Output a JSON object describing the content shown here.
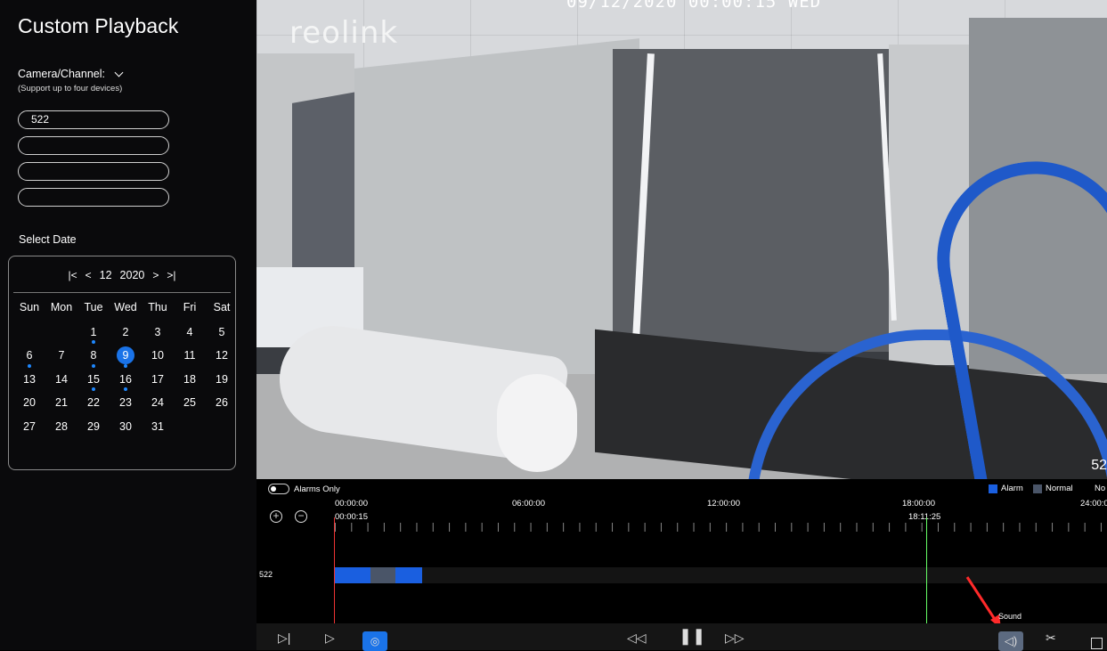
{
  "sidebar": {
    "title": "Custom Playback",
    "camera_label": "Camera/Channel:",
    "camera_sub": "(Support up to four devices)",
    "devices": [
      "522",
      "",
      "",
      ""
    ],
    "select_date": "Select Date"
  },
  "calendar": {
    "month": "12",
    "year": "2020",
    "weekdays": [
      "Sun",
      "Mon",
      "Tue",
      "Wed",
      "Thu",
      "Fri",
      "Sat"
    ],
    "days": [
      "",
      "",
      "1",
      "2",
      "3",
      "4",
      "5",
      "6",
      "7",
      "8",
      "9",
      "10",
      "11",
      "12",
      "13",
      "14",
      "15",
      "16",
      "17",
      "18",
      "19",
      "20",
      "21",
      "22",
      "23",
      "24",
      "25",
      "26",
      "27",
      "28",
      "29",
      "30",
      "31",
      "",
      ""
    ],
    "selected_day": "9",
    "days_with_recordings": [
      "1",
      "6",
      "8",
      "9",
      "15",
      "16"
    ]
  },
  "video": {
    "watermark": "reolink",
    "osd_timestamp": "09/12/2020 00:00:15 WED",
    "channel_overlay": "52"
  },
  "timeline": {
    "alarms_only": "Alarms Only",
    "legend": {
      "alarm": "Alarm",
      "normal": "Normal",
      "none": "No"
    },
    "time_marks": [
      "00:00:00",
      "06:00:00",
      "12:00:00",
      "18:00:00",
      "24:00:0"
    ],
    "cursor_time": "00:00:15",
    "hover_time": "18:11:25",
    "track_label": "522",
    "sound_tooltip": "Sound"
  },
  "colors": {
    "alarm": "#1a5fe0",
    "normal": "#4a5568",
    "accent": "#1a73e8"
  },
  "icons": {
    "zoom_in": "zoom-in-icon",
    "zoom_out": "zoom-out-icon",
    "rewind": "rewind-icon",
    "pause": "pause-icon",
    "fast_forward": "fast-forward-icon",
    "sound": "speaker-icon",
    "clip": "scissors-icon"
  }
}
